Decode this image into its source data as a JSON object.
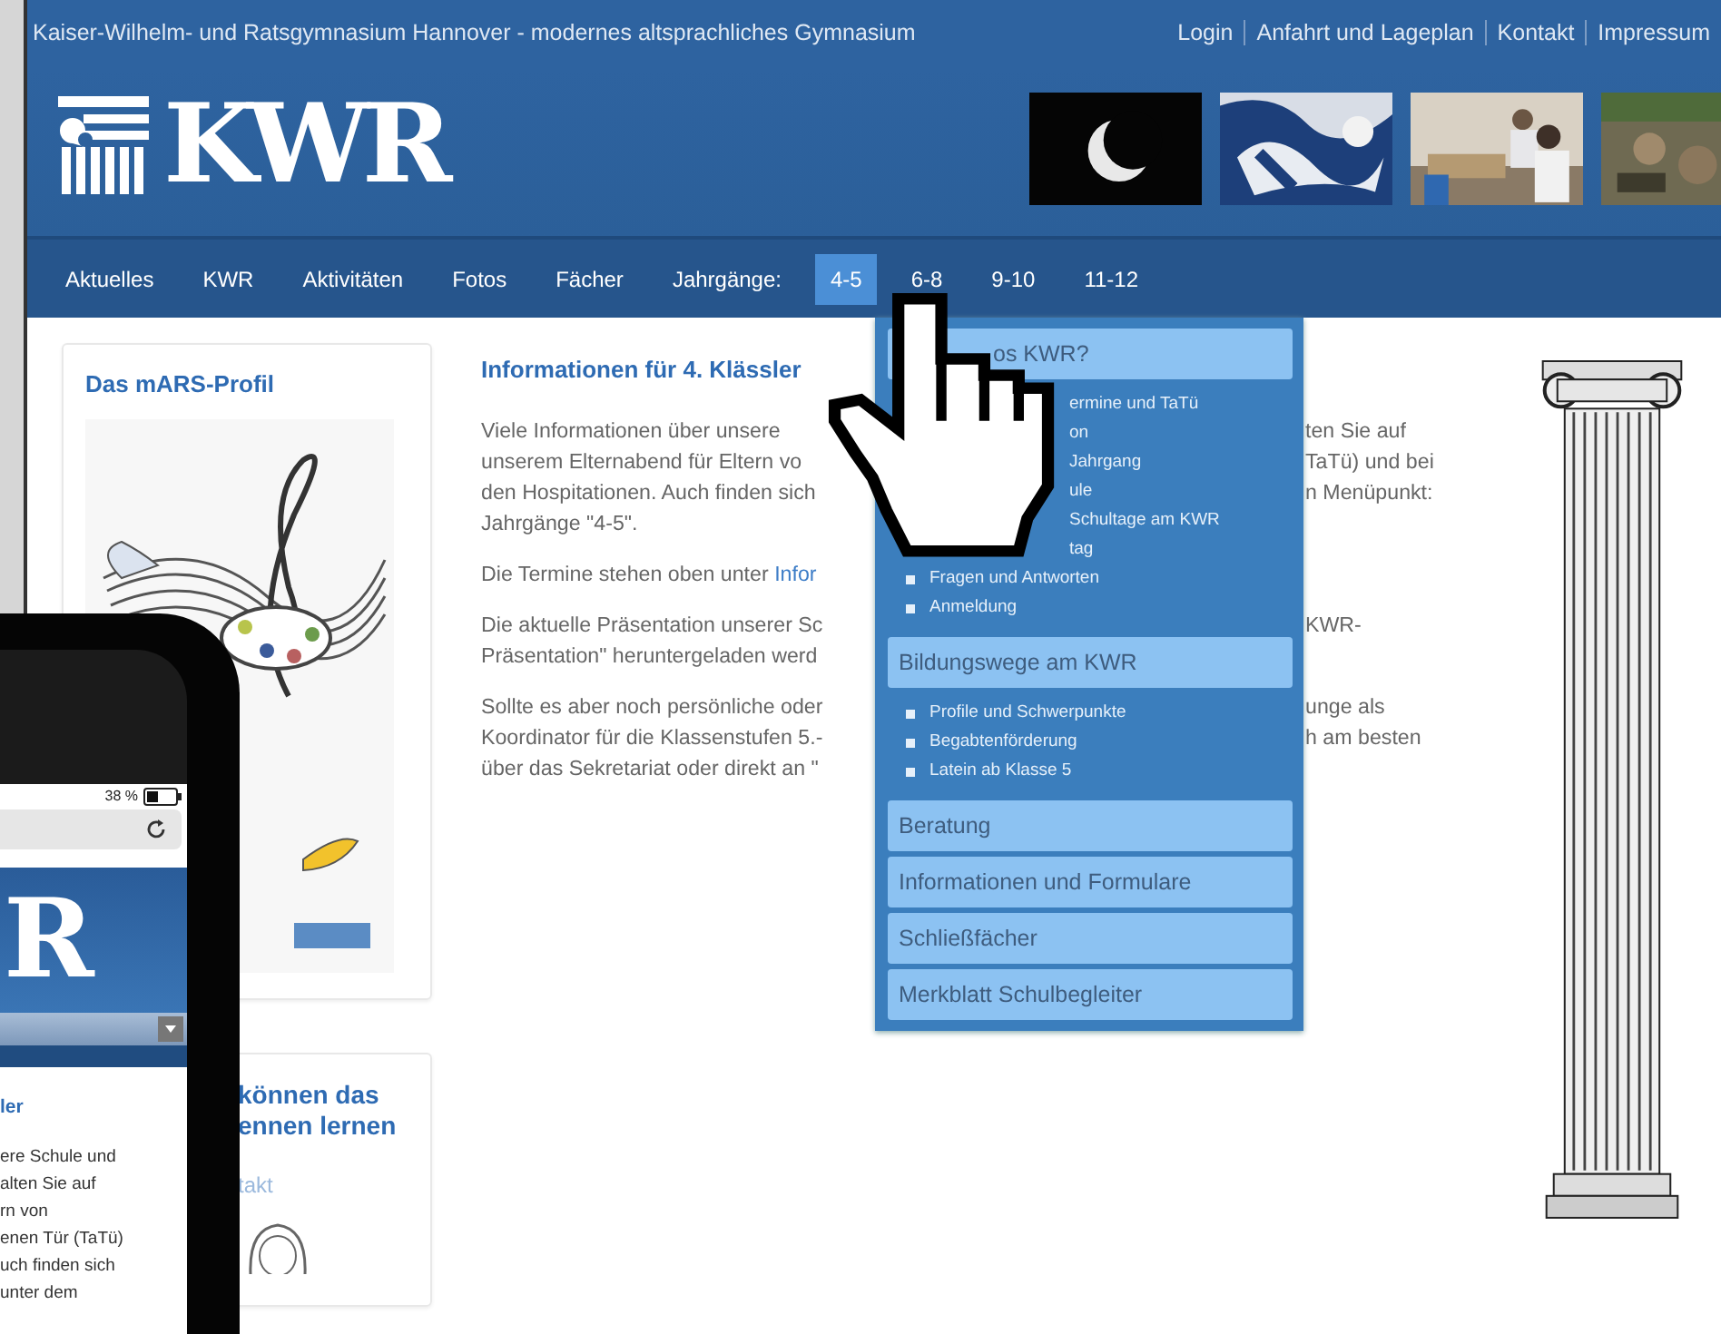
{
  "top_bar": {
    "title": "Kaiser-Wilhelm- und Ratsgymnasium Hannover - modernes altsprachliches Gymnasium",
    "links": [
      "Login",
      "Anfahrt und Lageplan",
      "Kontakt",
      "Impressum"
    ]
  },
  "logo": {
    "text": "KWR"
  },
  "nav": [
    {
      "label": "Aktuelles",
      "kind": "link",
      "selected": false
    },
    {
      "label": "KWR",
      "kind": "link",
      "selected": false
    },
    {
      "label": "Aktivitäten",
      "kind": "link",
      "selected": false
    },
    {
      "label": "Fotos",
      "kind": "link",
      "selected": false
    },
    {
      "label": "Fächer",
      "kind": "link",
      "selected": false
    },
    {
      "label": "Jahrgänge:",
      "kind": "label"
    },
    {
      "label": "4-5",
      "kind": "link",
      "selected": true
    },
    {
      "label": "6-8",
      "kind": "link",
      "selected": false
    },
    {
      "label": "9-10",
      "kind": "link",
      "selected": false
    },
    {
      "label": "11-12",
      "kind": "link",
      "selected": false
    }
  ],
  "profile_card": {
    "title": "Das mARS-Profil"
  },
  "contact_card": {
    "title_lines": [
      "können das",
      "ennen lernen"
    ],
    "link": "takt"
  },
  "article": {
    "heading": "Informationen für 4. Klässler",
    "paragraphs": [
      {
        "lines": [
          {
            "left": "Viele Informationen über unsere",
            "right": "ten Sie auf"
          },
          {
            "left": "unserem Elternabend für Eltern vo",
            "right": "TaTü) und bei"
          },
          {
            "left": "den Hospitationen. Auch finden sich",
            "right": "n Menüpunkt:"
          },
          {
            "left": "Jahrgänge \"4-5\"."
          }
        ]
      },
      {
        "lines": [
          {
            "left": "Die Termine stehen oben unter ",
            "link": "Infor"
          }
        ]
      },
      {
        "lines": [
          {
            "left": "Die aktuelle Präsentation unserer Sc",
            "right": "KWR-"
          },
          {
            "left": "Präsentation\" heruntergeladen werd"
          }
        ]
      },
      {
        "lines": [
          {
            "left": "Sollte es aber noch persönliche oder",
            "right": "unge als"
          },
          {
            "left": "Koordinator für die Klassenstufen 5.-",
            "right": "h am besten"
          },
          {
            "left": "über das Sekretariat oder direkt an \""
          }
        ]
      }
    ]
  },
  "dropdown": {
    "groups": [
      {
        "title": "os KWR?",
        "covered": true,
        "items": [
          {
            "label": "ermine und TaTü",
            "covered": true
          },
          {
            "label": "on",
            "covered": true
          },
          {
            "label": "Jahrgang",
            "covered": true
          },
          {
            "label": "ule",
            "covered": true
          },
          {
            "label": "Schultage am KWR",
            "covered": true
          },
          {
            "label": "tag",
            "covered": true
          },
          {
            "label": "Fragen und Antworten",
            "covered": false
          },
          {
            "label": "Anmeldung",
            "covered": false
          }
        ]
      },
      {
        "title": "Bildungswege am KWR",
        "covered": false,
        "items": [
          {
            "label": "Profile und Schwerpunkte",
            "covered": false
          },
          {
            "label": "Begabtenförderung",
            "covered": false
          },
          {
            "label": "Latein ab Klasse 5",
            "covered": false
          }
        ]
      },
      {
        "title": "Beratung",
        "covered": false
      },
      {
        "title": "Informationen und Formulare",
        "covered": false
      },
      {
        "title": "Schließfächer",
        "covered": false
      },
      {
        "title": "Merkblatt Schulbegleiter",
        "covered": false
      }
    ]
  },
  "phone": {
    "battery": "38 %",
    "logo_text": "R",
    "heading": "ler",
    "lines": [
      "ere Schule und",
      "alten Sie auf",
      "rn von",
      "enen Tür (TaTü)",
      "uch finden sich",
      "unter dem"
    ]
  }
}
